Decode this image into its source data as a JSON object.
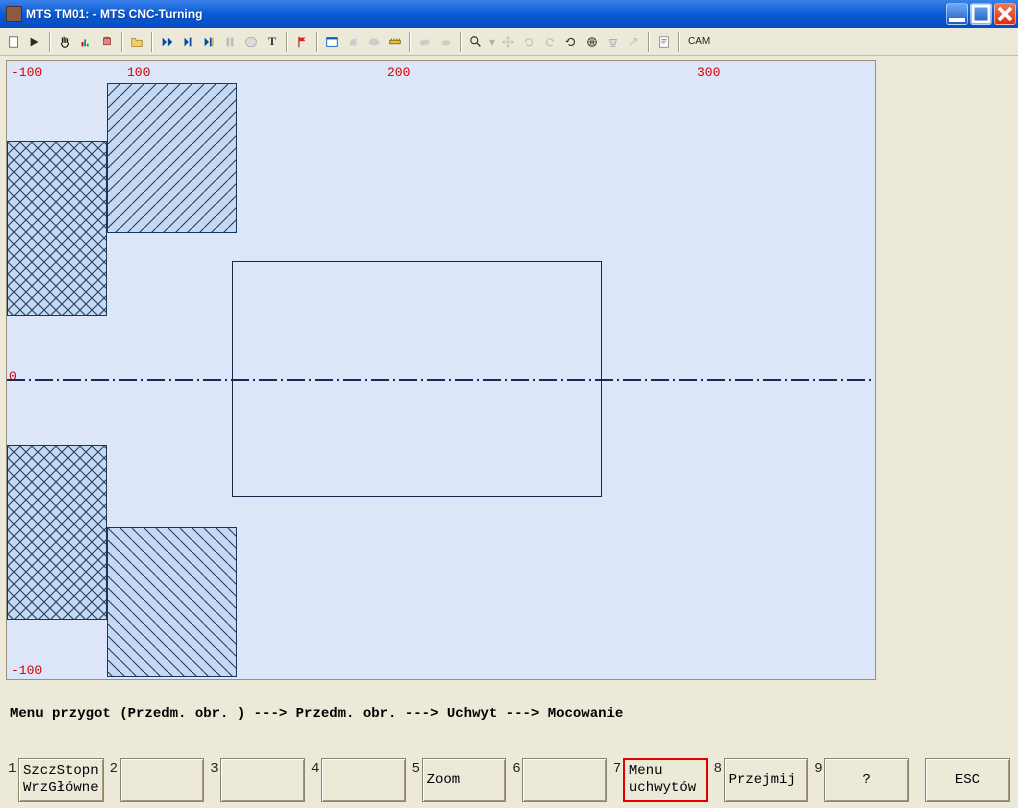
{
  "window": {
    "title": "MTS TM01:  - MTS CNC-Turning"
  },
  "toolbar": {
    "cam_label": "CAM"
  },
  "canvas": {
    "ruler_top": [
      "-100",
      "100",
      "200",
      "300"
    ],
    "ruler_left_zero": "0",
    "ruler_left_neg": "-100"
  },
  "breadcrumb": "Menu przygot (Przedm. obr. ) ---> Przedm. obr. ---> Uchwyt ---> Mocowanie",
  "fn": [
    {
      "num": "1",
      "line1": "SzczStopn",
      "line2": "WrzGłówne"
    },
    {
      "num": "2",
      "line1": "",
      "line2": ""
    },
    {
      "num": "3",
      "line1": "",
      "line2": ""
    },
    {
      "num": "4",
      "line1": "",
      "line2": ""
    },
    {
      "num": "5",
      "line1": "Zoom",
      "line2": ""
    },
    {
      "num": "6",
      "line1": "",
      "line2": ""
    },
    {
      "num": "7",
      "line1": "Menu",
      "line2": "uchwytów",
      "highlight": true
    },
    {
      "num": "8",
      "line1": "Przejmij",
      "line2": ""
    },
    {
      "num": "9",
      "line1": "?",
      "line2": ""
    }
  ],
  "esc": {
    "label": "ESC"
  }
}
